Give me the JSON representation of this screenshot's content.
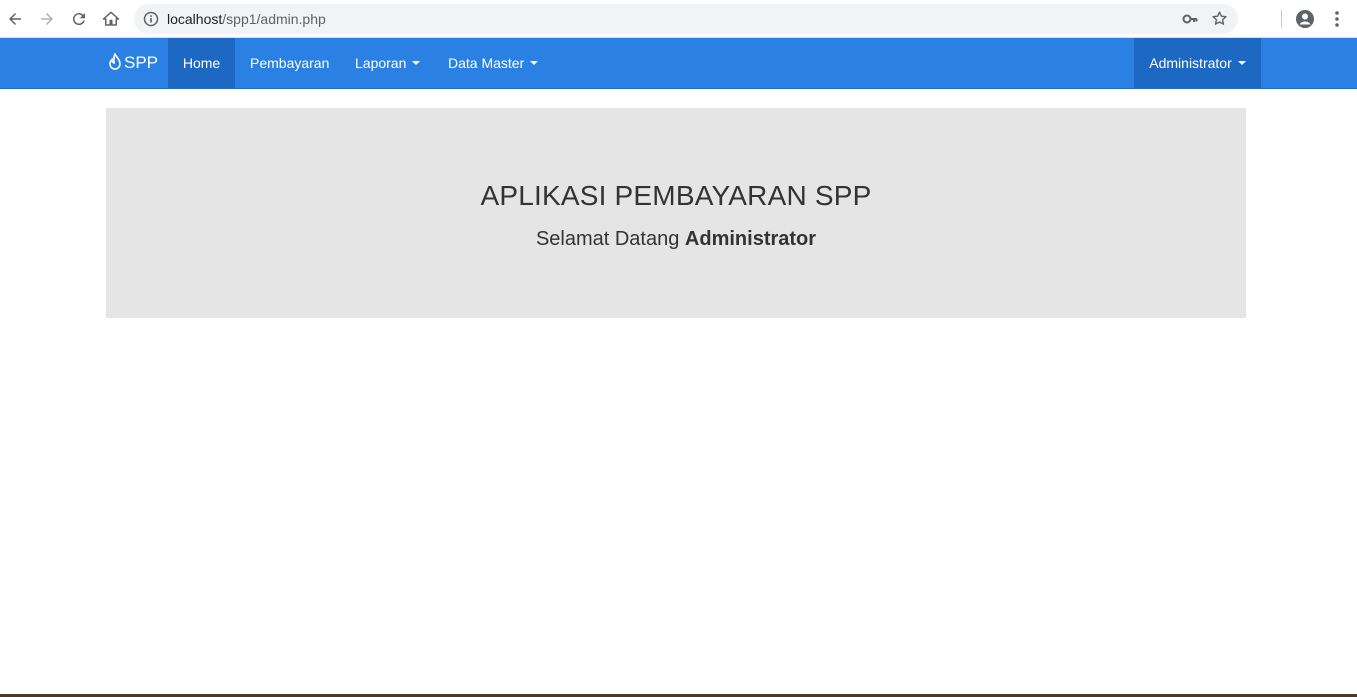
{
  "browser": {
    "url_host": "localhost",
    "url_path": "/spp1/admin.php"
  },
  "navbar": {
    "brand": "SPP",
    "items": [
      {
        "label": "Home",
        "active": true
      },
      {
        "label": "Pembayaran",
        "dropdown": false
      },
      {
        "label": "Laporan",
        "dropdown": true
      },
      {
        "label": "Data Master",
        "dropdown": true
      }
    ],
    "user_menu": "Administrator",
    "color": "#2a80e3",
    "active_color": "#1c68c2"
  },
  "jumbotron": {
    "title": "APLIKASI PEMBAYARAN SPP",
    "welcome_prefix": "Selamat Datang ",
    "welcome_user": "Administrator"
  }
}
